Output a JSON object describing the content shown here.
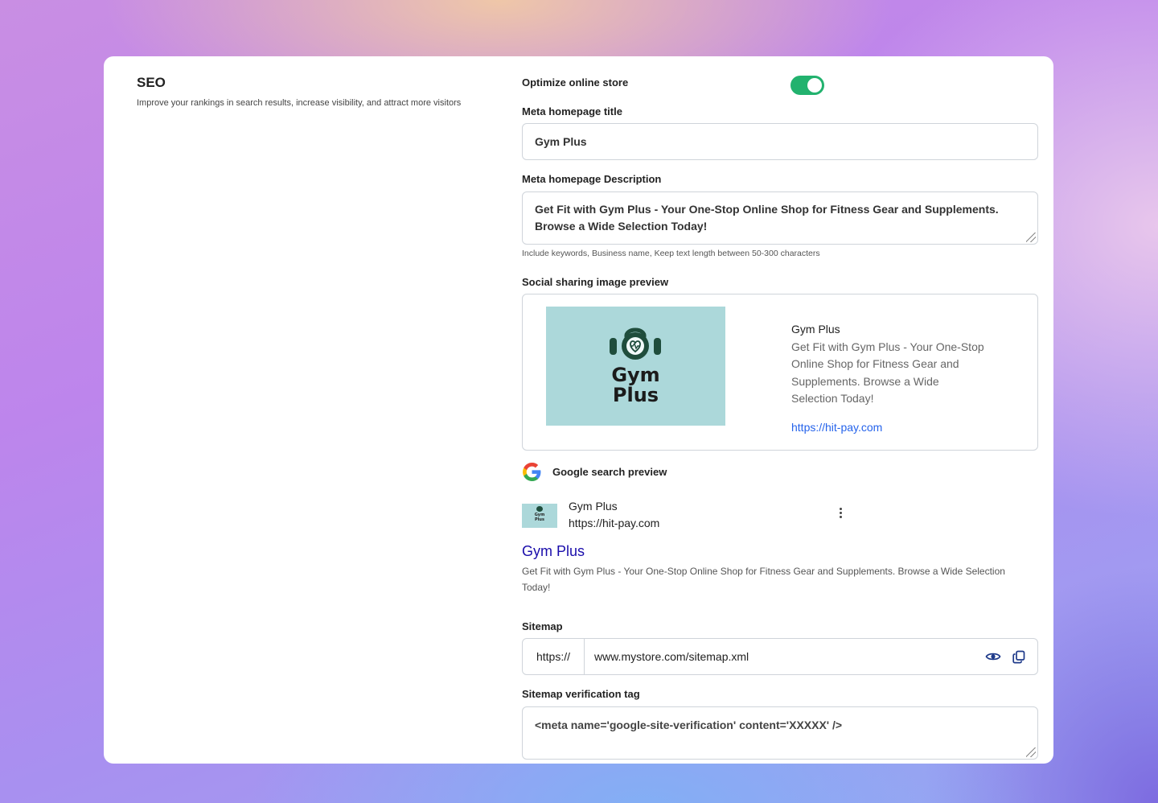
{
  "seo": {
    "title": "SEO",
    "subtitle": "Improve your rankings in search results, increase visibility, and attract more visitors"
  },
  "optimize": {
    "label": "Optimize online store",
    "enabled": true
  },
  "meta_title": {
    "label": "Meta homepage title",
    "value": "Gym Plus"
  },
  "meta_description": {
    "label": "Meta homepage Description",
    "value": "Get Fit with Gym Plus - Your One-Stop Online Shop for Fitness Gear and Supplements. Browse a Wide Selection Today!",
    "helper": "Include keywords, Business name, Keep text length between 50-300 characters"
  },
  "social_preview": {
    "label": "Social sharing image preview",
    "logo_line1": "Gym",
    "logo_line2": "Plus",
    "name": "Gym Plus",
    "description": "Get Fit with Gym Plus - Your One-Stop Online Shop for Fitness Gear and Supplements. Browse a Wide Selection Today!",
    "url": "https://hit-pay.com"
  },
  "google_preview": {
    "label": "Google search preview",
    "site_name": "Gym Plus",
    "site_url": "https://hit-pay.com",
    "thumb_line1": "Gym",
    "thumb_line2": "Plus",
    "result_title": "Gym Plus",
    "result_description": "Get Fit with Gym Plus - Your One-Stop Online Shop for Fitness Gear and Supplements. Browse a Wide Selection Today!"
  },
  "sitemap": {
    "label": "Sitemap",
    "prefix": "https://",
    "value": "www.mystore.com/sitemap.xml"
  },
  "verification": {
    "label": "Sitemap verification tag",
    "value": "<meta name='google-site-verification' content='XXXXX' />"
  },
  "colors": {
    "toggle_on": "#22b26e",
    "link": "#2563eb",
    "google_title": "#1a0dab",
    "image_bg": "#acd8da"
  },
  "icons": [
    "google-icon",
    "kettlebell-icon",
    "more-vertical-icon",
    "eye-icon",
    "copy-icon"
  ]
}
